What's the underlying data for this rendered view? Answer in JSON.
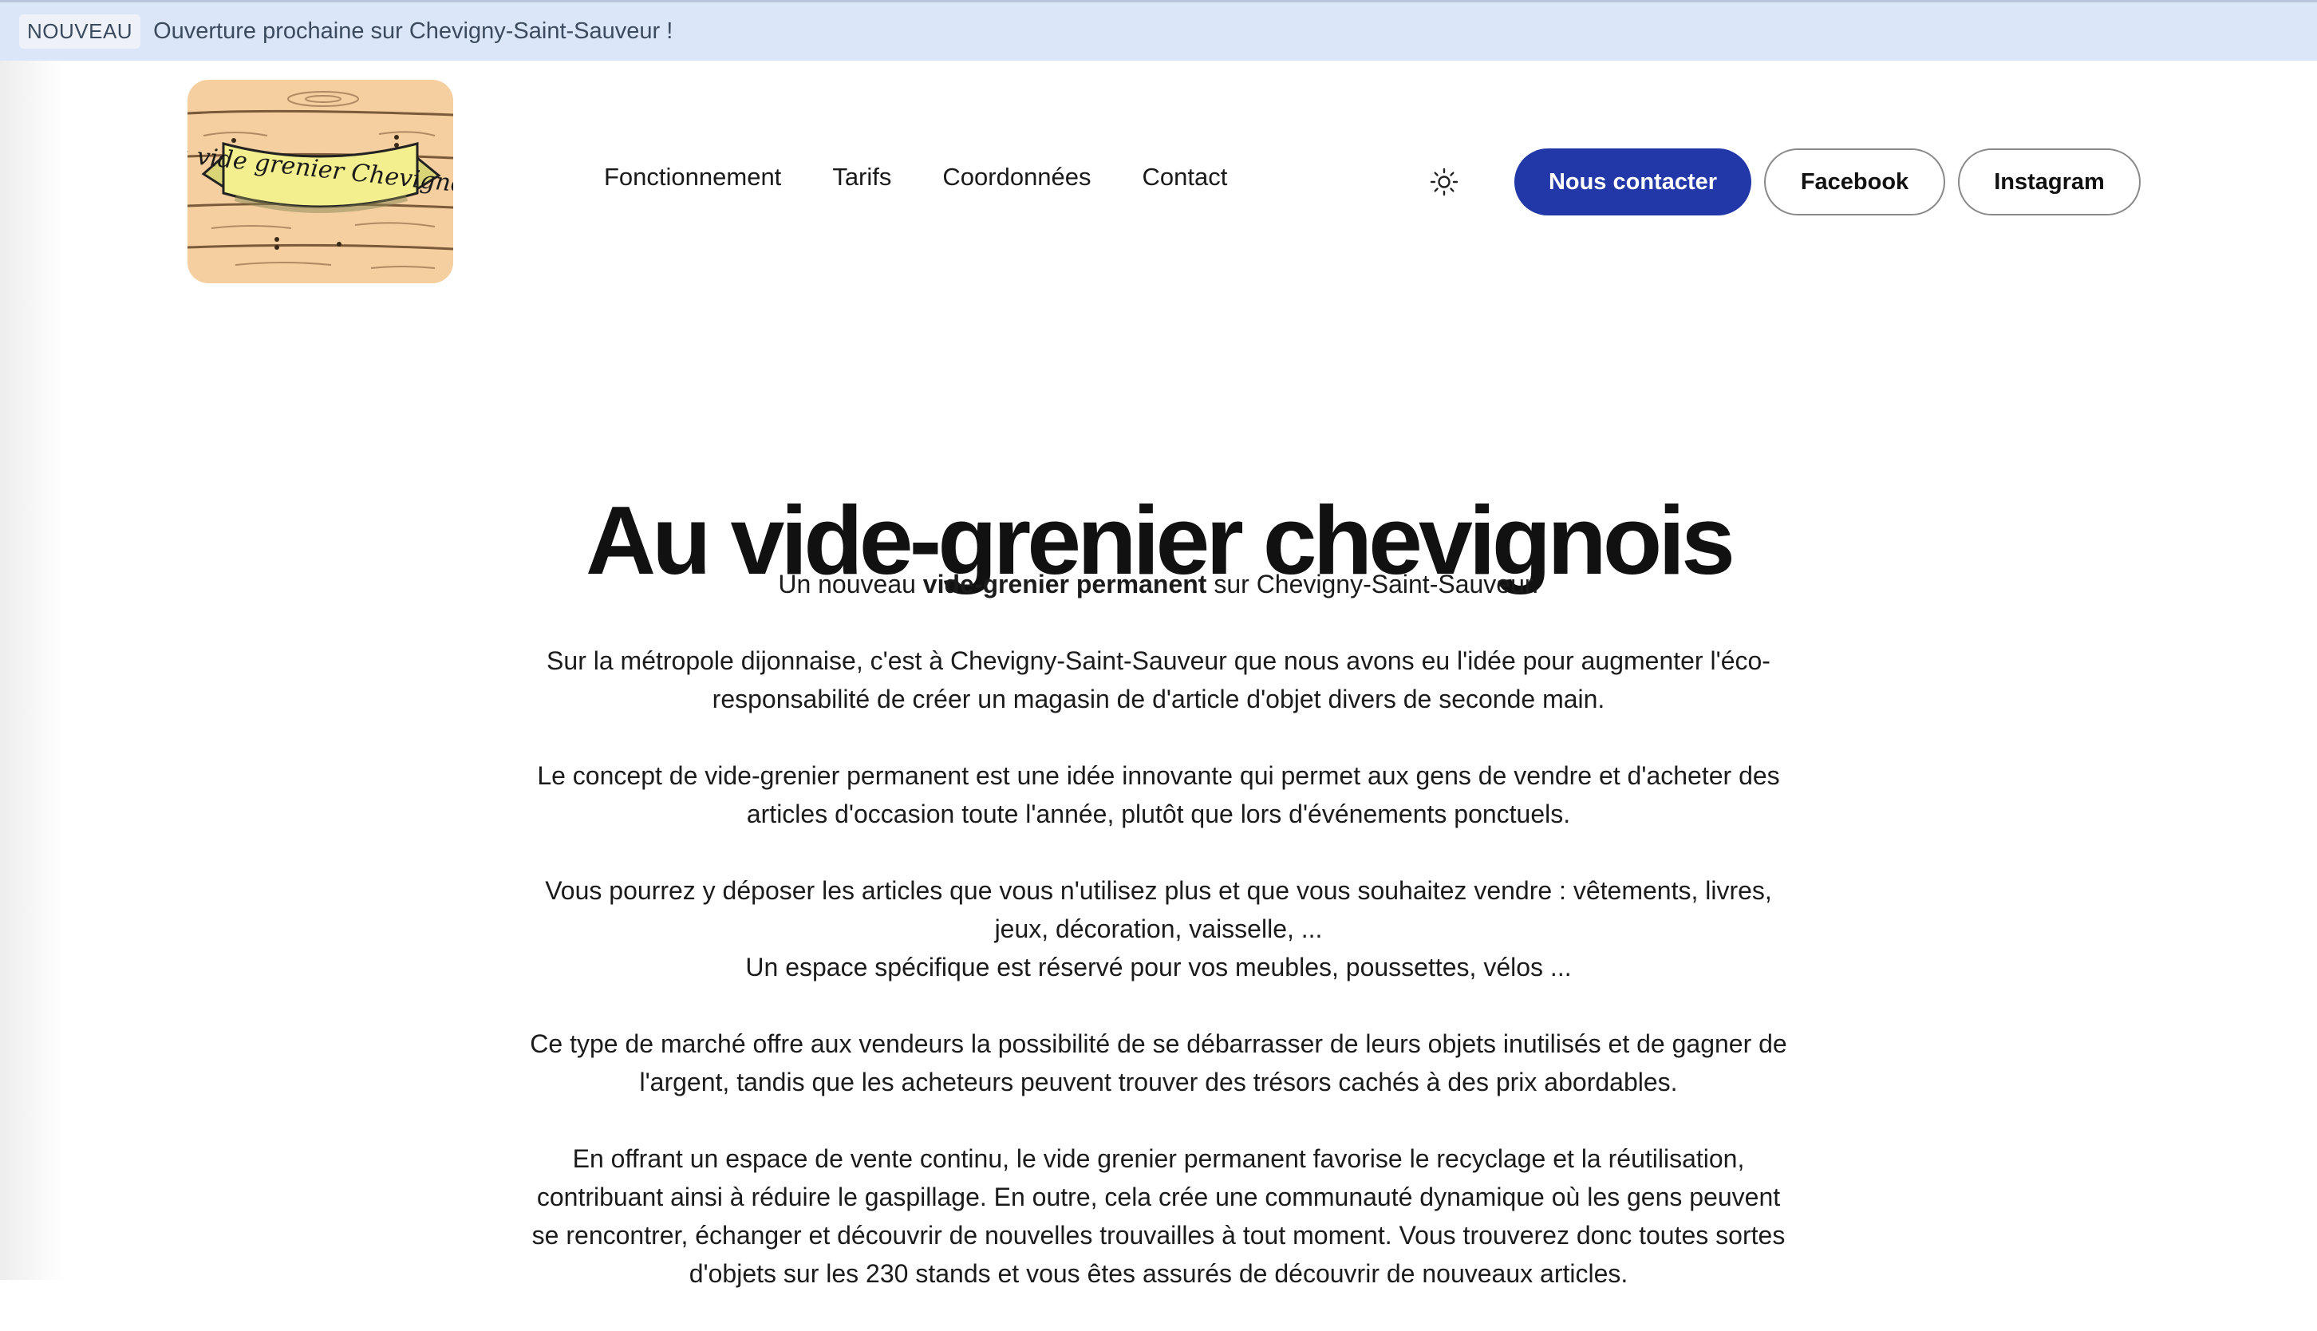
{
  "announcement": {
    "badge": "NOUVEAU",
    "text": "Ouverture prochaine sur Chevigny-Saint-Sauveur !"
  },
  "header": {
    "logo_text": "Au vide grenier Chevignois",
    "nav": [
      "Fonctionnement",
      "Tarifs",
      "Coordonnées",
      "Contact"
    ],
    "theme_icon": "sun-icon",
    "buttons": {
      "contact": "Nous contacter",
      "facebook": "Facebook",
      "instagram": "Instagram"
    }
  },
  "hero": {
    "title": "Au vide-grenier chevignois",
    "intro": {
      "before": "Un nouveau ",
      "bold": "vide-grenier permanent",
      "after": " sur Chevigny-Saint-Sauveur."
    },
    "paragraphs": [
      "Sur la métropole dijonnaise, c'est à Chevigny-Saint-Sauveur que nous avons eu l'idée pour augmenter l'éco-responsabilité de créer un magasin de d'article d'objet divers de seconde main.",
      "Le concept de vide-grenier permanent est une idée innovante qui permet aux gens de vendre et d'acheter des articles d'occasion toute l'année, plutôt que lors d'événements ponctuels.",
      "Vous pourrez y déposer les articles que vous n'utilisez plus et que vous souhaitez vendre : vêtements, livres, jeux, décoration, vaisselle, ...",
      "Un espace spécifique est réservé pour vos meubles, poussettes, vélos ...",
      "Ce type de marché offre aux vendeurs la possibilité de se débarrasser de leurs objets inutilisés et de gagner de l'argent, tandis que les acheteurs peuvent trouver des trésors cachés à des prix abordables.",
      "En offrant un espace de vente continu, le vide grenier permanent favorise le recyclage et la réutilisation, contribuant ainsi à réduire le gaspillage. En outre, cela crée une communauté dynamique où les gens peuvent se rencontrer, échanger et découvrir de nouvelles trouvailles à tout moment. Vous trouverez donc toutes sortes d'objets sur les 230 stands et vous êtes assurés de découvrir de nouveaux articles."
    ]
  },
  "colors": {
    "banner_bg": "#dbe7f8",
    "primary": "#2338a8",
    "logo_wood": "#f5cf9f",
    "logo_ribbon": "#f3ef8f"
  }
}
